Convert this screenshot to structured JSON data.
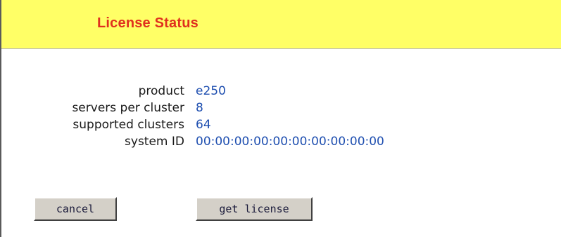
{
  "header": {
    "title": "License Status",
    "background_color": "#ffff66",
    "title_color": "#e0301e"
  },
  "license_info": {
    "rows": [
      {
        "label": "product",
        "value": "e250"
      },
      {
        "label": "servers per cluster",
        "value": "8"
      },
      {
        "label": "supported clusters",
        "value": "64"
      },
      {
        "label": "system ID",
        "value": "00:00:00:00:00:00:00:00:00:00"
      }
    ],
    "value_color": "#1f4fb0"
  },
  "actions": {
    "cancel_label": "cancel",
    "get_license_label": "get license"
  }
}
